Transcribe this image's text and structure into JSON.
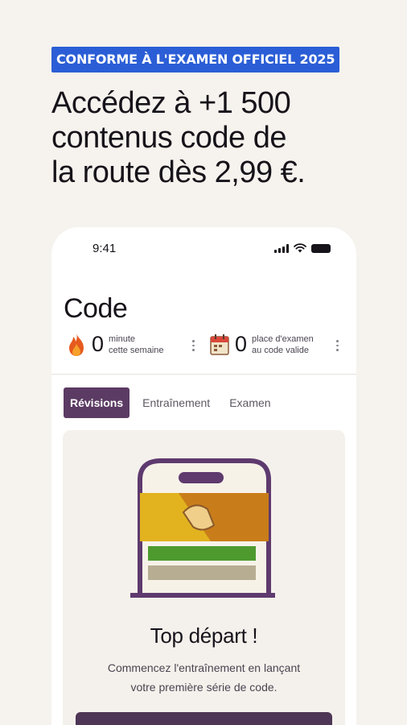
{
  "banner": {
    "badge": "CONFORME À L'EXAMEN OFFICIEL 2025"
  },
  "headline": {
    "line1": "Accédez à +1 500",
    "line2": "contenus code de",
    "line3": "la route dès 2,99 €."
  },
  "status_bar": {
    "time": "9:41"
  },
  "page": {
    "title": "Code"
  },
  "stats": [
    {
      "value": "0",
      "label_line1": "minute",
      "label_line2": "cette semaine",
      "icon": "flame-icon"
    },
    {
      "value": "0",
      "label_line1": "place d'examen",
      "label_line2": "au code valide",
      "icon": "calendar-icon"
    }
  ],
  "tabs": [
    {
      "label": "Révisions",
      "active": true
    },
    {
      "label": "Entraînement",
      "active": false
    },
    {
      "label": "Examen",
      "active": false
    }
  ],
  "card": {
    "title": "Top départ !",
    "desc_line1": "Commencez l'entraînement en lançant",
    "desc_line2": "votre première série de code."
  },
  "colors": {
    "badge": "#2b5ed6",
    "accent": "#5b3b63",
    "background": "#f6f3ee"
  }
}
